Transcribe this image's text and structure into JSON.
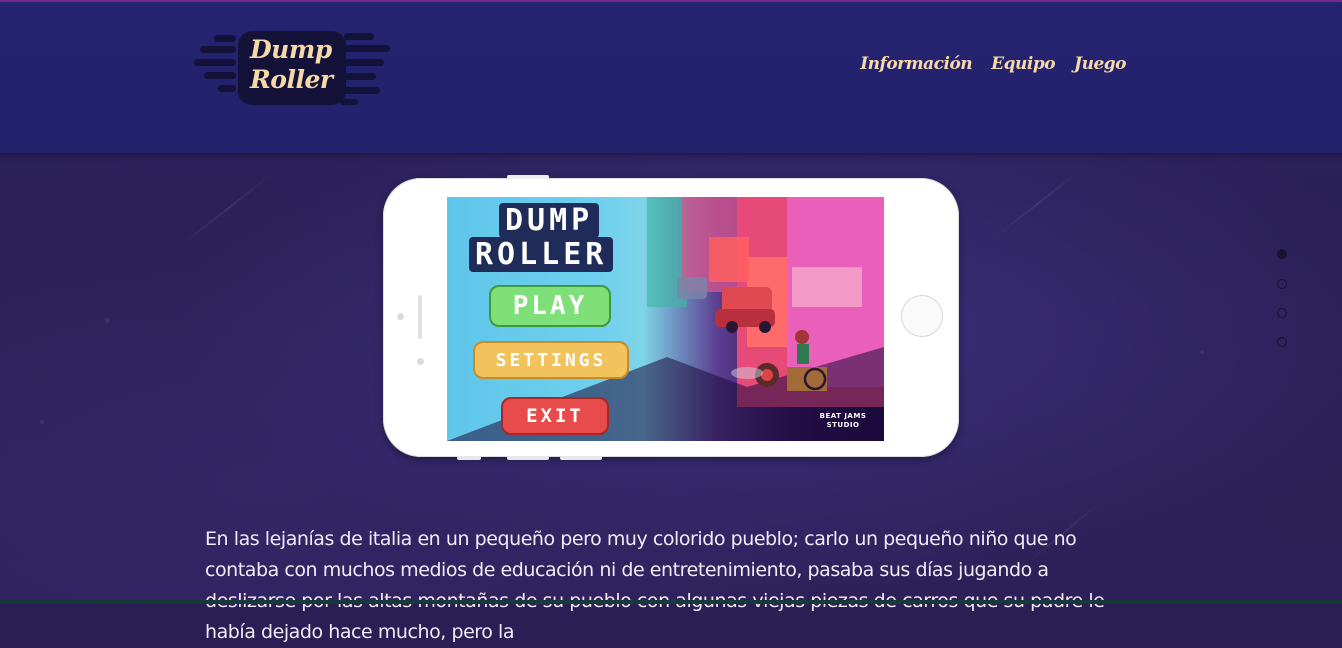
{
  "site": {
    "logo": {
      "line1": "Dump",
      "line2": "Roller"
    },
    "nav": [
      {
        "label": "Información"
      },
      {
        "label": "Equipo"
      },
      {
        "label": "Juego"
      }
    ]
  },
  "game_screen": {
    "title_line1": "DUMP",
    "title_line2": "ROLLER",
    "buttons": [
      {
        "label": "PLAY",
        "color": "#7fe07a"
      },
      {
        "label": "SETTINGS",
        "color": "#f2c25c"
      },
      {
        "label": "EXIT",
        "color": "#e84b4b"
      }
    ],
    "studio_line1": "BEAT JAMS",
    "studio_line2": "STUDIO"
  },
  "slider_dots": {
    "count": 4,
    "active_index": 0
  },
  "story": {
    "text": "En las lejanías de italia en un pequeño pero muy colorido pueblo; carlo un pequeño niño que no contaba con muchos medios de educación ni de entretenimiento, pasaba sus días jugando a deslizarse por las altas montañas de su pueblo con algunas viejas piezas de carros que su padre le había dejado hace mucho, pero la"
  },
  "colors": {
    "header_bg": "#252270",
    "page_bg": "#2a1f55",
    "accent_text": "#f6d9a8",
    "body_text": "#f0ecf6"
  }
}
